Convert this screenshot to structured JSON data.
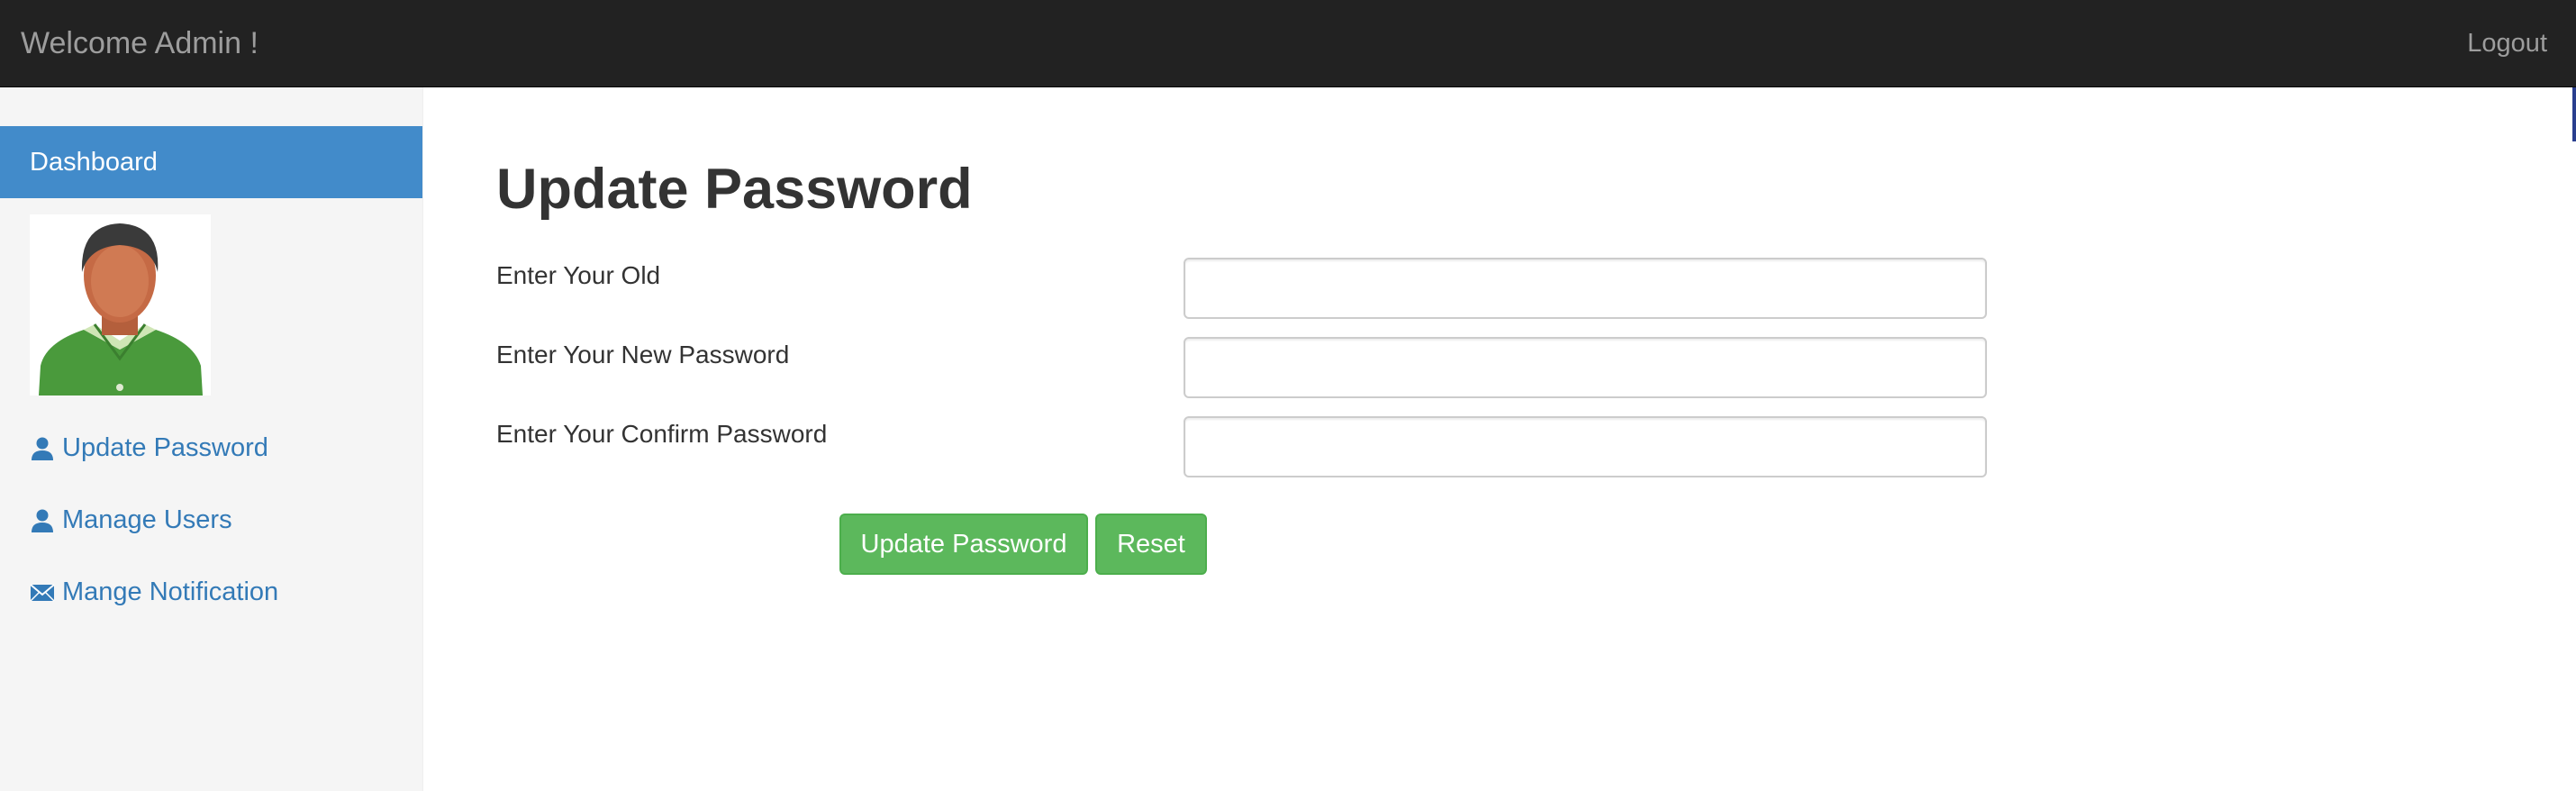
{
  "navbar": {
    "brand": "Welcome Admin !",
    "logout_label": "Logout"
  },
  "sidebar": {
    "active_item": "Dashboard",
    "items": [
      {
        "label": "Update Password",
        "icon": "user-icon"
      },
      {
        "label": "Manage Users",
        "icon": "user-icon"
      },
      {
        "label": "Mange Notification",
        "icon": "envelope-icon"
      }
    ]
  },
  "main": {
    "title": "Update Password",
    "fields": [
      {
        "label": "Enter Your Old",
        "value": "",
        "placeholder": ""
      },
      {
        "label": "Enter Your New Password",
        "value": "",
        "placeholder": ""
      },
      {
        "label": "Enter Your Confirm Password",
        "value": "",
        "placeholder": ""
      }
    ],
    "submit_label": "Update Password",
    "reset_label": "Reset"
  },
  "colors": {
    "navbar_bg": "#222222",
    "navbar_text": "#9d9d9d",
    "sidebar_active_bg": "#428bca",
    "link": "#337ab7",
    "button_success": "#5cb85c",
    "sidebar_bg": "#f5f5f5"
  }
}
